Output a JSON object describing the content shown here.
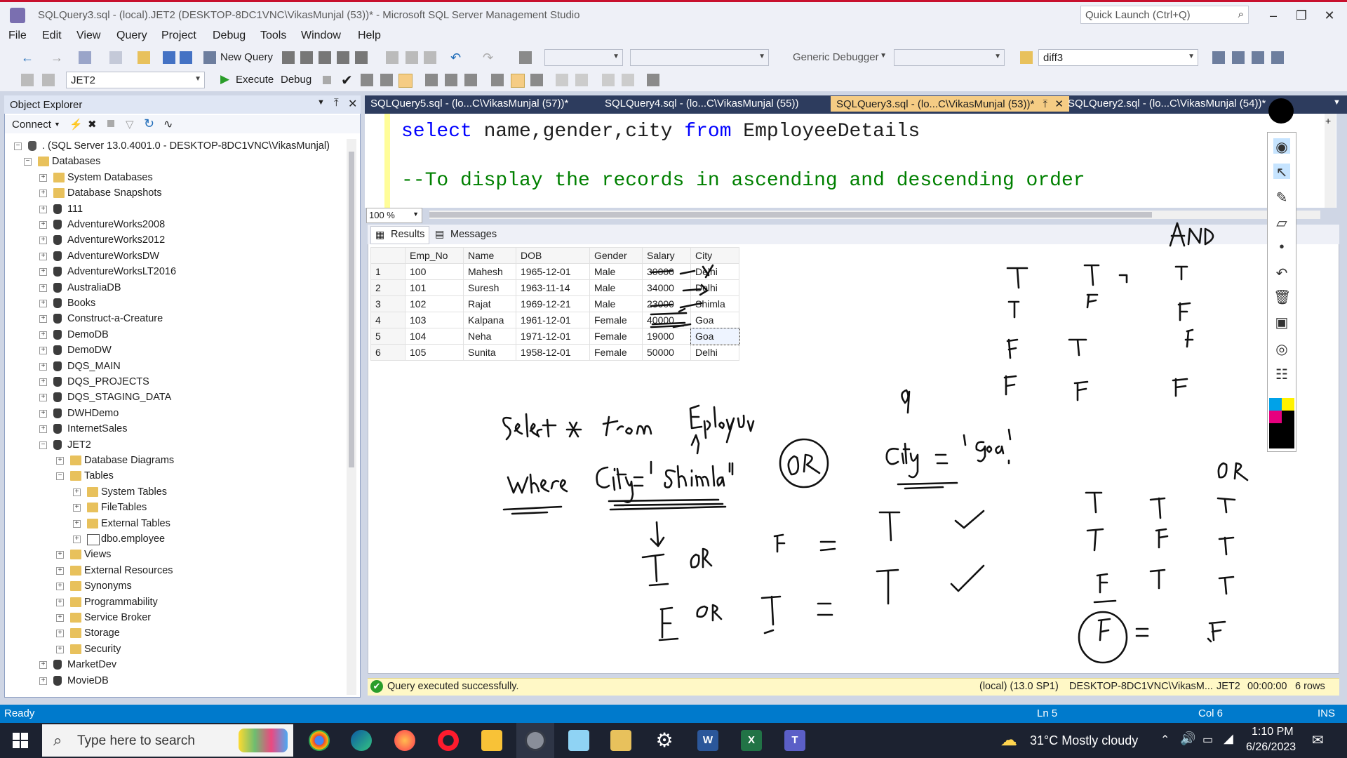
{
  "window": {
    "title": "SQLQuery3.sql - (local).JET2 (DESKTOP-8DC1VNC\\VikasMunjal (53))* - Microsoft SQL Server Management Studio",
    "quick_launch_placeholder": "Quick Launch (Ctrl+Q)"
  },
  "menu": [
    "File",
    "Edit",
    "View",
    "Query",
    "Project",
    "Debug",
    "Tools",
    "Window",
    "Help"
  ],
  "toolbar": {
    "new_query": "New Query",
    "debugger": "Generic Debugger",
    "search_value": "diff3",
    "database": "JET2",
    "execute": "Execute",
    "debug": "Debug"
  },
  "object_explorer": {
    "title": "Object Explorer",
    "connect": "Connect",
    "server": ". (SQL Server 13.0.4001.0 - DESKTOP-8DC1VNC\\VikasMunjal)",
    "nodes": [
      {
        "label": "Databases",
        "level": 1,
        "icon": "folder",
        "state": "open"
      },
      {
        "label": "System Databases",
        "level": 2,
        "icon": "folder",
        "state": "closed"
      },
      {
        "label": "Database Snapshots",
        "level": 2,
        "icon": "folder",
        "state": "closed"
      },
      {
        "label": "111",
        "level": 2,
        "icon": "db",
        "state": "closed"
      },
      {
        "label": "AdventureWorks2008",
        "level": 2,
        "icon": "db",
        "state": "closed"
      },
      {
        "label": "AdventureWorks2012",
        "level": 2,
        "icon": "db",
        "state": "closed"
      },
      {
        "label": "AdventureWorksDW",
        "level": 2,
        "icon": "db",
        "state": "closed"
      },
      {
        "label": "AdventureWorksLT2016",
        "level": 2,
        "icon": "db",
        "state": "closed"
      },
      {
        "label": "AustraliaDB",
        "level": 2,
        "icon": "db",
        "state": "closed"
      },
      {
        "label": "Books",
        "level": 2,
        "icon": "db",
        "state": "closed"
      },
      {
        "label": "Construct-a-Creature",
        "level": 2,
        "icon": "db",
        "state": "closed"
      },
      {
        "label": "DemoDB",
        "level": 2,
        "icon": "db",
        "state": "closed"
      },
      {
        "label": "DemoDW",
        "level": 2,
        "icon": "db",
        "state": "closed"
      },
      {
        "label": "DQS_MAIN",
        "level": 2,
        "icon": "db",
        "state": "closed"
      },
      {
        "label": "DQS_PROJECTS",
        "level": 2,
        "icon": "db",
        "state": "closed"
      },
      {
        "label": "DQS_STAGING_DATA",
        "level": 2,
        "icon": "db",
        "state": "closed"
      },
      {
        "label": "DWHDemo",
        "level": 2,
        "icon": "db",
        "state": "closed"
      },
      {
        "label": "InternetSales",
        "level": 2,
        "icon": "db",
        "state": "closed"
      },
      {
        "label": "JET2",
        "level": 2,
        "icon": "db",
        "state": "open"
      },
      {
        "label": "Database Diagrams",
        "level": 3,
        "icon": "folder",
        "state": "closed"
      },
      {
        "label": "Tables",
        "level": 3,
        "icon": "folder",
        "state": "open"
      },
      {
        "label": "System Tables",
        "level": 4,
        "icon": "folder",
        "state": "closed"
      },
      {
        "label": "FileTables",
        "level": 4,
        "icon": "folder",
        "state": "closed"
      },
      {
        "label": "External Tables",
        "level": 4,
        "icon": "folder",
        "state": "closed"
      },
      {
        "label": "dbo.employee",
        "level": 4,
        "icon": "table",
        "state": "closed"
      },
      {
        "label": "Views",
        "level": 3,
        "icon": "folder",
        "state": "closed"
      },
      {
        "label": "External Resources",
        "level": 3,
        "icon": "folder",
        "state": "closed"
      },
      {
        "label": "Synonyms",
        "level": 3,
        "icon": "folder",
        "state": "closed"
      },
      {
        "label": "Programmability",
        "level": 3,
        "icon": "folder",
        "state": "closed"
      },
      {
        "label": "Service Broker",
        "level": 3,
        "icon": "folder",
        "state": "closed"
      },
      {
        "label": "Storage",
        "level": 3,
        "icon": "folder",
        "state": "closed"
      },
      {
        "label": "Security",
        "level": 3,
        "icon": "folder",
        "state": "closed"
      },
      {
        "label": "MarketDev",
        "level": 2,
        "icon": "db",
        "state": "closed"
      },
      {
        "label": "MovieDB",
        "level": 2,
        "icon": "db",
        "state": "closed"
      }
    ]
  },
  "tabs": [
    {
      "label": "SQLQuery5.sql - (lo...C\\VikasMunjal (57))*",
      "active": false
    },
    {
      "label": "SQLQuery4.sql - (lo...C\\VikasMunjal (55))",
      "active": false
    },
    {
      "label": "SQLQuery3.sql - (lo...C\\VikasMunjal (53))*",
      "active": true
    },
    {
      "label": "SQLQuery2.sql - (lo...C\\VikasMunjal (54))*",
      "active": false
    }
  ],
  "editor": {
    "line1": {
      "kw1": "select",
      "cols": " name,gender,city ",
      "kw2": "from",
      "table": " EmployeeDetails"
    },
    "line2": "--To display the records in ascending  and descending order",
    "zoom": "100 %"
  },
  "results": {
    "tab_results": "Results",
    "tab_messages": "Messages",
    "columns": [
      "",
      "Emp_No",
      "Name",
      "DOB",
      "Gender",
      "Salary",
      "City"
    ],
    "rows": [
      [
        "1",
        "100",
        "Mahesh",
        "1965-12-01",
        "Male",
        "30000",
        "Delhi"
      ],
      [
        "2",
        "101",
        "Suresh",
        "1963-11-14",
        "Male",
        "34000",
        "Delhi"
      ],
      [
        "3",
        "102",
        "Rajat",
        "1969-12-21",
        "Male",
        "23000",
        "Shimla"
      ],
      [
        "4",
        "103",
        "Kalpana",
        "1961-12-01",
        "Female",
        "40000",
        "Goa"
      ],
      [
        "5",
        "104",
        "Neha",
        "1971-12-01",
        "Female",
        "19000",
        "Goa"
      ],
      [
        "6",
        "105",
        "Sunita",
        "1958-12-01",
        "Female",
        "50000",
        "Delhi"
      ]
    ]
  },
  "query_status": {
    "message": "Query executed successfully.",
    "server": "(local) (13.0 SP1)",
    "user": "DESKTOP-8DC1VNC\\VikasM...",
    "db": "JET2",
    "time": "00:00:00",
    "rows": "6 rows"
  },
  "statusbar": {
    "left": "Ready",
    "ln": "Ln 5",
    "col": "Col 6",
    "mode": "INS"
  },
  "taskbar": {
    "search_placeholder": "Type here to search",
    "weather": "31°C  Mostly cloudy",
    "time": "1:10 PM",
    "date": "6/26/2023"
  },
  "handwriting": [
    "AND",
    "Select * from Employee",
    "where City = 'Shimla'",
    "OR",
    "City = 'Goa'",
    "T OR F =",
    "T",
    "F OR T =",
    "OR",
    "T",
    "T",
    "T",
    "T",
    "F",
    "F",
    "F",
    "T",
    "F",
    "F",
    "F",
    "F",
    "T",
    "T",
    "T",
    "T",
    "F",
    "T",
    "F",
    "T",
    "T",
    "F",
    "F",
    "F",
    "q"
  ],
  "colors": {
    "accent": "#007acc",
    "tab_bar": "#2d3c5e",
    "active_tab": "#f5cc84",
    "keyword": "#0000ff",
    "comment": "#008000",
    "taskbar": "#1c2230"
  }
}
